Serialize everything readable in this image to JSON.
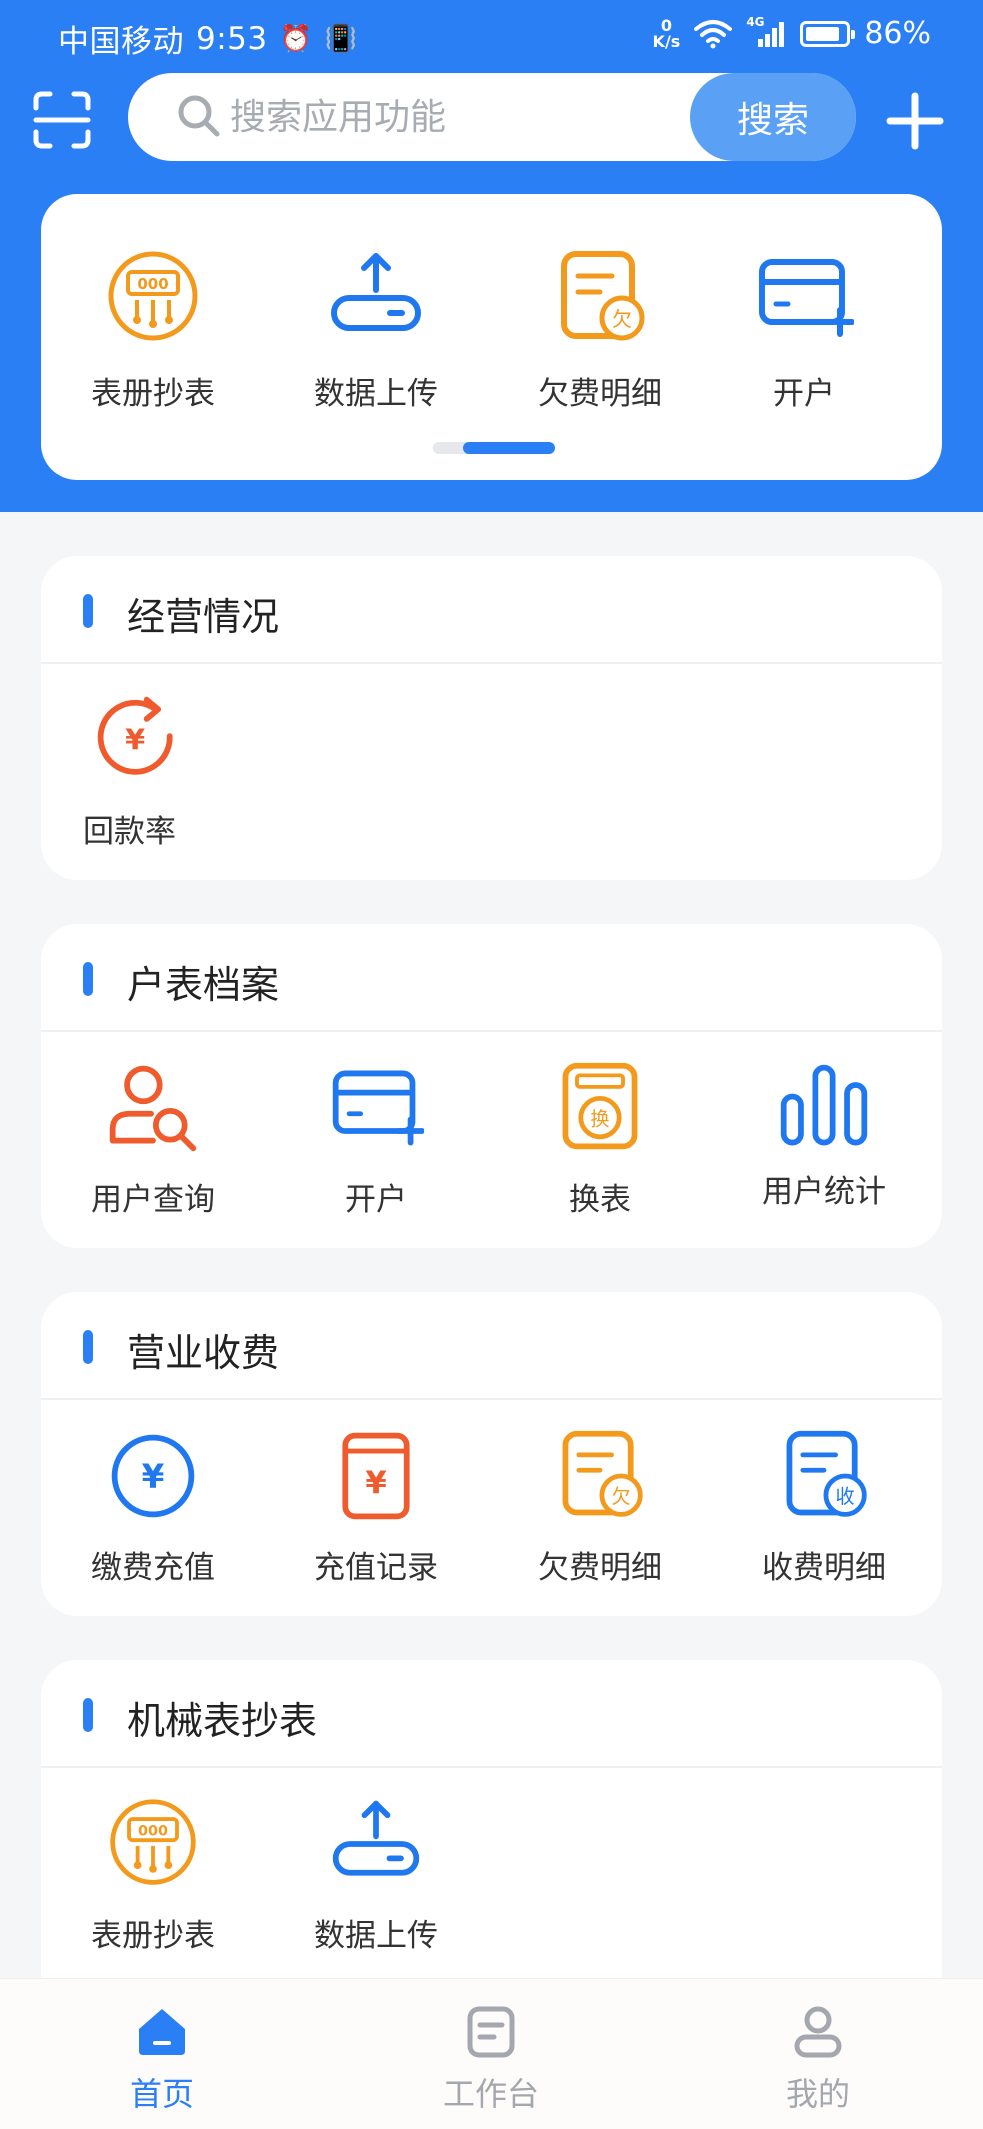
{
  "status_bar": {
    "carrier": "中国移动",
    "time": "9:53",
    "net_speed_value": "0",
    "net_speed_unit": "K/s",
    "signal_type": "4G",
    "battery_percent": "86%",
    "battery_level": 0.86
  },
  "header": {
    "search_placeholder": "搜索应用功能",
    "search_button": "搜索"
  },
  "quick_access": {
    "items": [
      {
        "label": "表册抄表",
        "icon": "meter-reading-icon"
      },
      {
        "label": "数据上传",
        "icon": "upload-icon"
      },
      {
        "label": "欠费明细",
        "icon": "arrears-detail-icon"
      },
      {
        "label": "开户",
        "icon": "open-account-card-icon"
      }
    ],
    "page_indicator": {
      "pages": 2,
      "current": 2
    }
  },
  "sections": [
    {
      "title": "经营情况",
      "items": [
        {
          "label": "回款率",
          "icon": "repayment-rate-icon"
        }
      ]
    },
    {
      "title": "户表档案",
      "items": [
        {
          "label": "用户查询",
          "icon": "user-search-icon"
        },
        {
          "label": "开户",
          "icon": "open-account-card-icon"
        },
        {
          "label": "换表",
          "icon": "meter-replace-icon",
          "badge": "换"
        },
        {
          "label": "用户统计",
          "icon": "user-statistics-icon"
        }
      ]
    },
    {
      "title": "营业收费",
      "items": [
        {
          "label": "缴费充值",
          "icon": "payment-recharge-icon",
          "badge": "¥"
        },
        {
          "label": "充值记录",
          "icon": "recharge-record-icon",
          "badge": "¥"
        },
        {
          "label": "欠费明细",
          "icon": "arrears-detail-icon",
          "badge": "欠"
        },
        {
          "label": "收费明细",
          "icon": "charge-detail-icon",
          "badge": "收"
        }
      ]
    },
    {
      "title": "机械表抄表",
      "items": [
        {
          "label": "表册抄表",
          "icon": "meter-reading-icon"
        },
        {
          "label": "数据上传",
          "icon": "upload-icon"
        }
      ]
    }
  ],
  "bottom_nav": {
    "items": [
      {
        "label": "首页",
        "icon": "home-icon",
        "active": true
      },
      {
        "label": "工作台",
        "icon": "workbench-icon",
        "active": false
      },
      {
        "label": "我的",
        "icon": "profile-icon",
        "active": false
      }
    ]
  },
  "colors": {
    "primary": "#2a7ff5",
    "search_button": "#5aa0f5",
    "orange": "#f39a1d",
    "red_orange": "#ef5b2c",
    "page_background": "#f5f6f8"
  },
  "icon_badges": {
    "arrears": "欠",
    "currency": "¥",
    "meter_digits": "000"
  }
}
